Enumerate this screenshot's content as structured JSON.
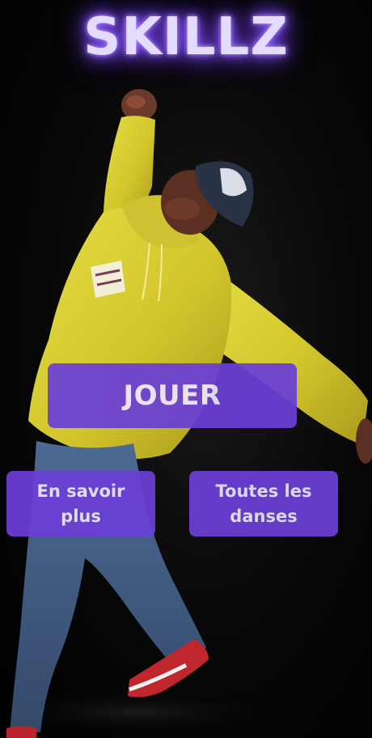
{
  "app": {
    "title": "SKILLZ"
  },
  "buttons": {
    "play_label": "JOUER",
    "learn_more_label": "En savoir plus",
    "all_dances_label": "Toutes les danses"
  },
  "theme": {
    "accent": "#6b3fd6",
    "title_glow": "#8f5cff",
    "button_text": "#ece6fb",
    "background": "#000000"
  },
  "background_image": {
    "subject": "dancer-in-yellow-hoodie"
  }
}
